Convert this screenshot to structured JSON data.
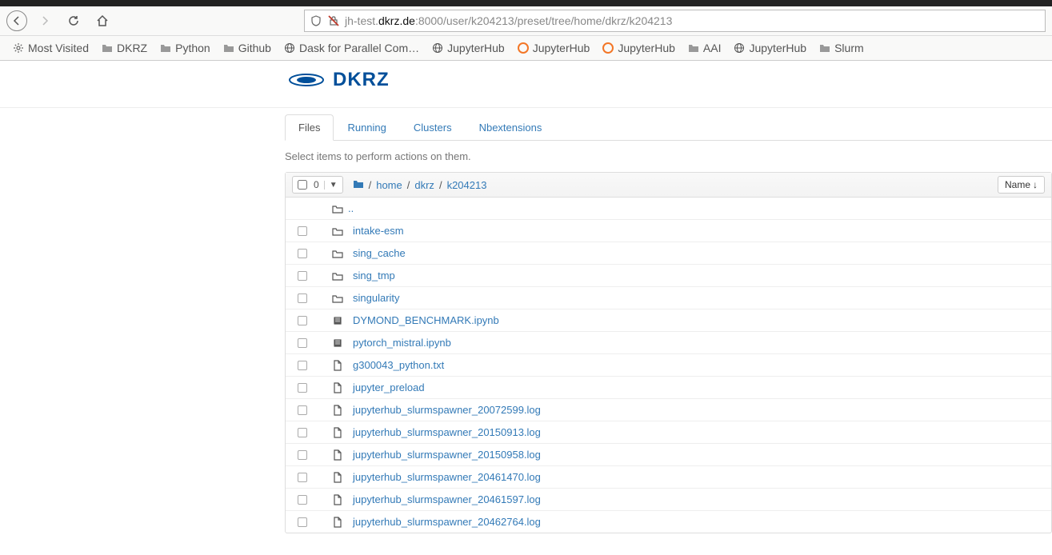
{
  "browser": {
    "url_prefix": "jh-test.",
    "url_domain": "dkrz.de",
    "url_suffix": ":8000/user/k204213/preset/tree/home/dkrz/k204213"
  },
  "bookmarks": [
    {
      "label": "Most Visited",
      "icon": "gear"
    },
    {
      "label": "DKRZ",
      "icon": "folder"
    },
    {
      "label": "Python",
      "icon": "folder"
    },
    {
      "label": "Github",
      "icon": "folder"
    },
    {
      "label": "Dask for Parallel Com…",
      "icon": "globe"
    },
    {
      "label": "JupyterHub",
      "icon": "globe"
    },
    {
      "label": "JupyterHub",
      "icon": "jupyter"
    },
    {
      "label": "JupyterHub",
      "icon": "jupyter"
    },
    {
      "label": "AAI",
      "icon": "folder"
    },
    {
      "label": "JupyterHub",
      "icon": "globe"
    },
    {
      "label": "Slurm",
      "icon": "folder"
    }
  ],
  "logo": "DKRZ",
  "tabs": [
    {
      "label": "Files",
      "active": true
    },
    {
      "label": "Running",
      "active": false
    },
    {
      "label": "Clusters",
      "active": false
    },
    {
      "label": "Nbextensions",
      "active": false
    }
  ],
  "action_hint": "Select items to perform actions on them.",
  "select_count": "0",
  "breadcrumb": [
    "home",
    "dkrz",
    "k204213"
  ],
  "sort_label": "Name",
  "files": [
    {
      "name": "..",
      "type": "parent"
    },
    {
      "name": "intake-esm",
      "type": "folder"
    },
    {
      "name": "sing_cache",
      "type": "folder"
    },
    {
      "name": "sing_tmp",
      "type": "folder"
    },
    {
      "name": "singularity",
      "type": "folder"
    },
    {
      "name": "DYMOND_BENCHMARK.ipynb",
      "type": "notebook"
    },
    {
      "name": "pytorch_mistral.ipynb",
      "type": "notebook"
    },
    {
      "name": "g300043_python.txt",
      "type": "file"
    },
    {
      "name": "jupyter_preload",
      "type": "file"
    },
    {
      "name": "jupyterhub_slurmspawner_20072599.log",
      "type": "file"
    },
    {
      "name": "jupyterhub_slurmspawner_20150913.log",
      "type": "file"
    },
    {
      "name": "jupyterhub_slurmspawner_20150958.log",
      "type": "file"
    },
    {
      "name": "jupyterhub_slurmspawner_20461470.log",
      "type": "file"
    },
    {
      "name": "jupyterhub_slurmspawner_20461597.log",
      "type": "file"
    },
    {
      "name": "jupyterhub_slurmspawner_20462764.log",
      "type": "file"
    }
  ]
}
